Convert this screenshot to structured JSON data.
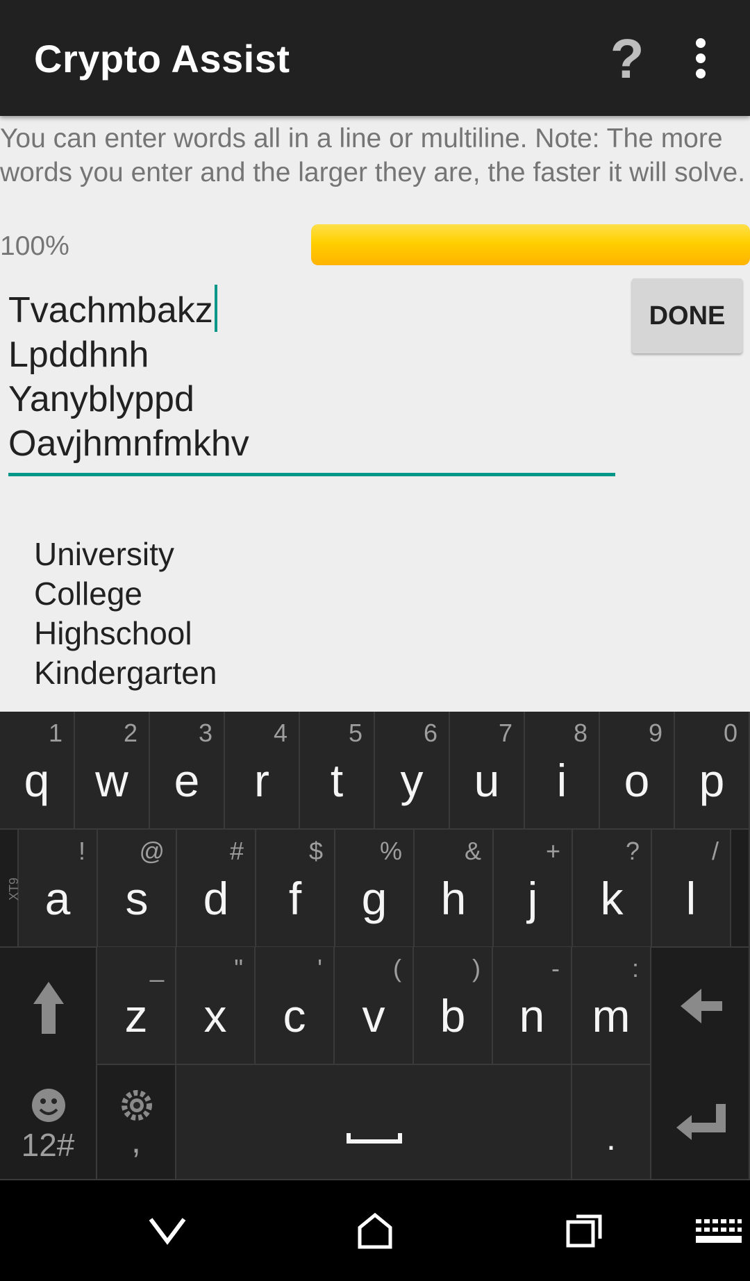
{
  "app_bar": {
    "title": "Crypto Assist",
    "help_label": "?",
    "icons": [
      "help-icon",
      "overflow-menu-icon"
    ]
  },
  "instructions": "You can enter words all in a line or multiline. Note: The more words you enter and the larger they are, the faster it will solve.",
  "progress": {
    "label": "100%",
    "value_percent": 100,
    "color": "#ffc400"
  },
  "editor": {
    "lines": [
      "Tvachmbakz",
      "Lpddhnh",
      "Yanyblyppd",
      "Oavjhmnfmkhv"
    ],
    "accent_color": "#009688"
  },
  "done_button": {
    "label": "DONE"
  },
  "results": [
    "University",
    "College",
    "Highschool",
    "Kindergarten"
  ],
  "keyboard": {
    "side_label": "XT9",
    "row1": [
      {
        "key": "q",
        "hint": "1"
      },
      {
        "key": "w",
        "hint": "2"
      },
      {
        "key": "e",
        "hint": "3"
      },
      {
        "key": "r",
        "hint": "4"
      },
      {
        "key": "t",
        "hint": "5"
      },
      {
        "key": "y",
        "hint": "6"
      },
      {
        "key": "u",
        "hint": "7"
      },
      {
        "key": "i",
        "hint": "8"
      },
      {
        "key": "o",
        "hint": "9"
      },
      {
        "key": "p",
        "hint": "0"
      }
    ],
    "row2": [
      {
        "key": "a",
        "hint": "!"
      },
      {
        "key": "s",
        "hint": "@"
      },
      {
        "key": "d",
        "hint": "#"
      },
      {
        "key": "f",
        "hint": "$"
      },
      {
        "key": "g",
        "hint": "%"
      },
      {
        "key": "h",
        "hint": "&"
      },
      {
        "key": "j",
        "hint": "+"
      },
      {
        "key": "k",
        "hint": "?"
      },
      {
        "key": "l",
        "hint": "/"
      }
    ],
    "row3": [
      {
        "key": "z",
        "hint": "_"
      },
      {
        "key": "x",
        "hint": "\""
      },
      {
        "key": "c",
        "hint": "'"
      },
      {
        "key": "v",
        "hint": "("
      },
      {
        "key": "b",
        "hint": ")"
      },
      {
        "key": "n",
        "hint": "-"
      },
      {
        "key": "m",
        "hint": ":"
      }
    ],
    "row4": {
      "symbols_label": "12#",
      "comma": ",",
      "period": "."
    },
    "icons": [
      "shift-icon",
      "backspace-icon",
      "emoji-icon",
      "settings-icon",
      "space-icon",
      "enter-icon"
    ]
  },
  "navbar": {
    "icons": [
      "back-icon",
      "home-icon",
      "recents-icon",
      "keyboard-icon"
    ]
  }
}
